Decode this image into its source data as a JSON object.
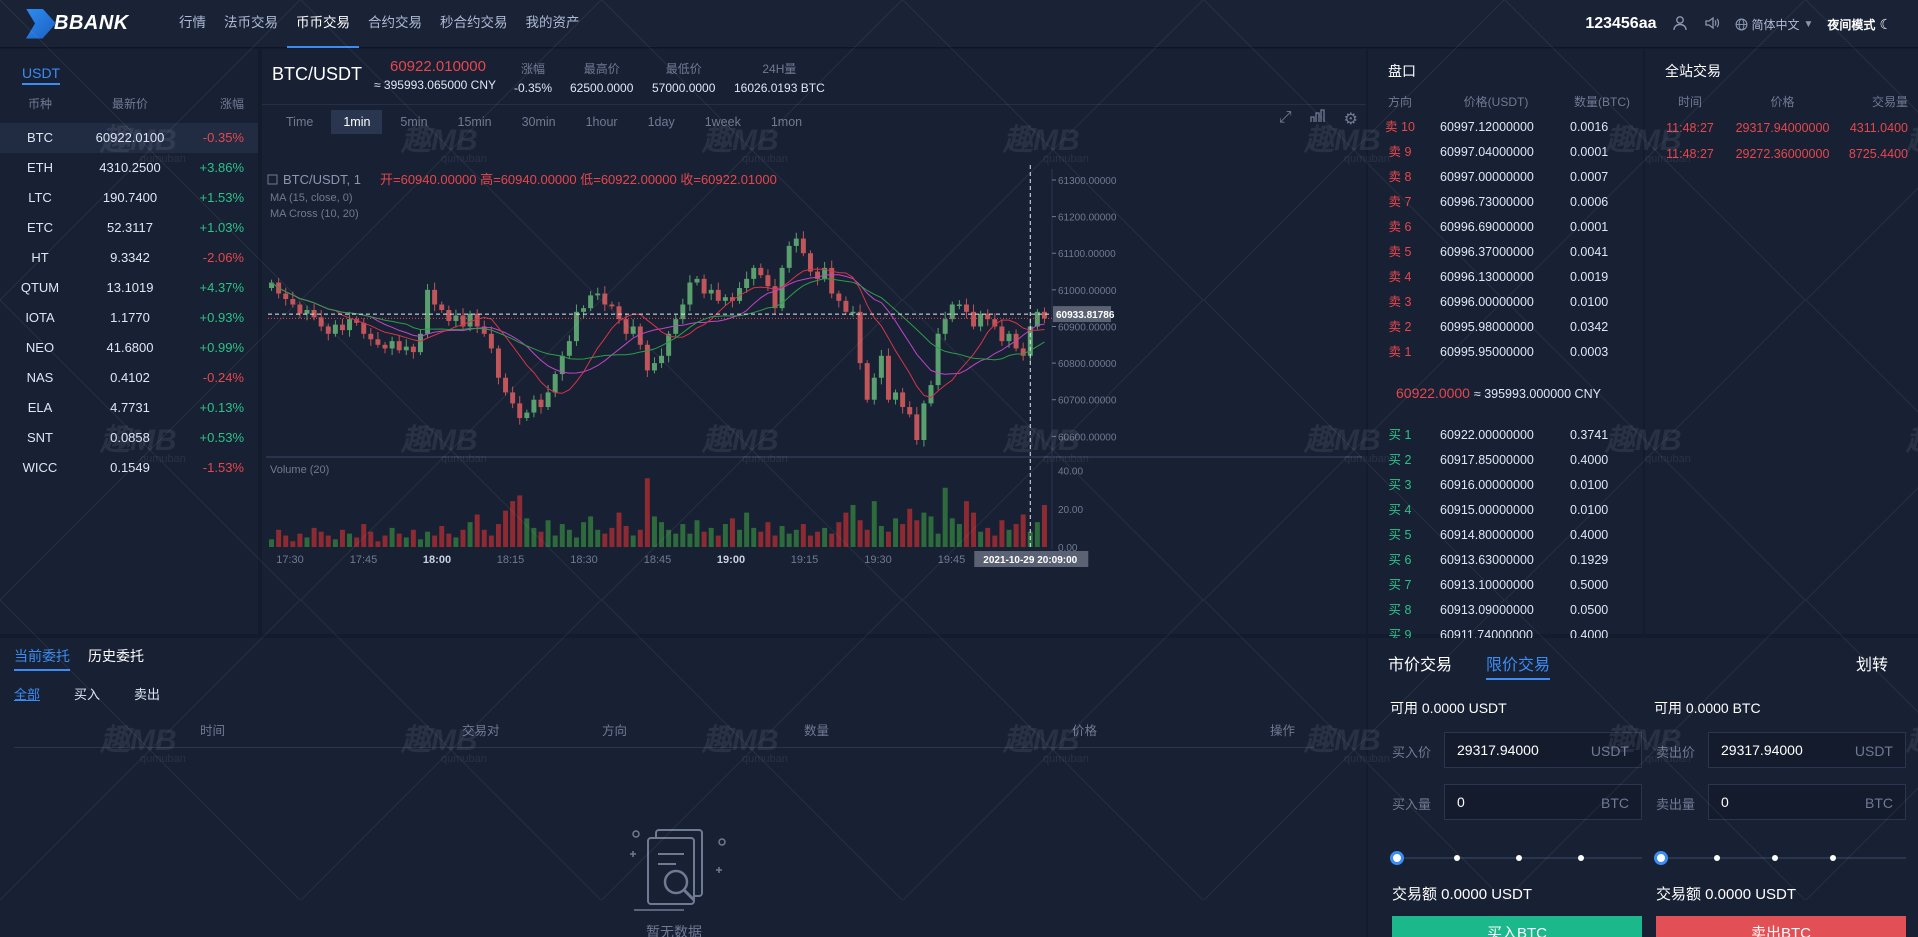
{
  "header": {
    "logo_text": "BBANK",
    "nav": [
      "行情",
      "法币交易",
      "币币交易",
      "合约交易",
      "秒合约交易",
      "我的资产"
    ],
    "active_nav": 2,
    "username": "123456aa",
    "language": "简体中文",
    "night_mode": "夜间模式"
  },
  "market": {
    "tab": "USDT",
    "columns": [
      "币种",
      "最新价",
      "涨幅"
    ],
    "rows": [
      {
        "coin": "BTC",
        "price": "60922.0100",
        "change": "-0.35%",
        "dir": "down",
        "selected": true
      },
      {
        "coin": "ETH",
        "price": "4310.2500",
        "change": "+3.86%",
        "dir": "up"
      },
      {
        "coin": "LTC",
        "price": "190.7400",
        "change": "+1.53%",
        "dir": "up"
      },
      {
        "coin": "ETC",
        "price": "52.3117",
        "change": "+1.03%",
        "dir": "up"
      },
      {
        "coin": "HT",
        "price": "9.3342",
        "change": "-2.06%",
        "dir": "down"
      },
      {
        "coin": "QTUM",
        "price": "13.1019",
        "change": "+4.37%",
        "dir": "up"
      },
      {
        "coin": "IOTA",
        "price": "1.1770",
        "change": "+0.93%",
        "dir": "up"
      },
      {
        "coin": "NEO",
        "price": "41.6800",
        "change": "+0.99%",
        "dir": "up"
      },
      {
        "coin": "NAS",
        "price": "0.4102",
        "change": "-0.24%",
        "dir": "down"
      },
      {
        "coin": "ELA",
        "price": "4.7731",
        "change": "+0.13%",
        "dir": "up"
      },
      {
        "coin": "SNT",
        "price": "0.0858",
        "change": "+0.53%",
        "dir": "up"
      },
      {
        "coin": "WICC",
        "price": "0.1549",
        "change": "-1.53%",
        "dir": "down"
      }
    ]
  },
  "ticker": {
    "pair": "BTC/USDT",
    "last_price": "60922.010000",
    "last_cny": "≈ 395993.065000 CNY",
    "change_label": "涨幅",
    "change_value": "-0.35%",
    "high_label": "最高价",
    "high_value": "62500.0000",
    "low_label": "最低价",
    "low_value": "57000.0000",
    "volume_label": "24H量",
    "volume_value": "16026.0193 BTC"
  },
  "timeframes": [
    "Time",
    "1min",
    "5min",
    "15min",
    "30min",
    "1hour",
    "1day",
    "1week",
    "1mon"
  ],
  "active_timeframe": 1,
  "chart_data": {
    "type": "candlestick",
    "legend_main": "BTC/USDT, 1",
    "ohlc_text": "开=60940.00000  高=60940.00000  低=60922.00000  收=60922.01000",
    "indicators": [
      "MA (15, close, 0)",
      "MA Cross (10, 20)"
    ],
    "volume_label": "Volume (20)",
    "price_ticks": [
      61300,
      61200,
      61100,
      61000,
      60900,
      60800,
      60700,
      60600
    ],
    "price_tick_labels": [
      "61300.00000",
      "61200.00000",
      "61100.00000",
      "61000.00000",
      "60900.00000",
      "60800.00000",
      "60700.00000",
      "60600.00000"
    ],
    "price_range": [
      60560,
      61330
    ],
    "volume_ticks": [
      "40.00",
      "20.00",
      "0.00"
    ],
    "volume_range": [
      0,
      45
    ],
    "time_ticks": [
      "17:30",
      "17:45",
      "18:00",
      "18:15",
      "18:30",
      "18:45",
      "19:00",
      "19:15",
      "19:30",
      "19:45"
    ],
    "crosshair_price": "60933.81786",
    "crosshair_time": "2021-10-29 20:09:00",
    "closes": [
      61020,
      60990,
      60975,
      60960,
      60935,
      60945,
      60925,
      60900,
      60880,
      60905,
      60890,
      60920,
      60910,
      60880,
      60865,
      60850,
      60840,
      60860,
      60835,
      60845,
      60830,
      60880,
      61000,
      60960,
      60945,
      60915,
      60930,
      60900,
      60935,
      60900,
      60880,
      60840,
      60760,
      60720,
      60690,
      60650,
      60665,
      60700,
      60680,
      60720,
      60770,
      60820,
      60860,
      60940,
      60950,
      60985,
      60990,
      60960,
      60955,
      60920,
      60880,
      60900,
      60850,
      60780,
      60800,
      60820,
      60880,
      60920,
      60960,
      61020,
      61030,
      60990,
      61000,
      60970,
      60980,
      60970,
      61005,
      61030,
      61060,
      61040,
      61010,
      60950,
      61060,
      61120,
      61140,
      61100,
      61050,
      61030,
      61060,
      60990,
      60970,
      60940,
      60940,
      60800,
      60700,
      60760,
      60820,
      60700,
      60720,
      60680,
      60660,
      60590,
      60690,
      60740,
      60880,
      60920,
      60960,
      60960,
      60940,
      60900,
      60935,
      60920,
      60900,
      60860,
      60880,
      60840,
      60820,
      60900,
      60940,
      60922
    ],
    "volumes": [
      4,
      9,
      6,
      3,
      7,
      5,
      10,
      8,
      6,
      4,
      9,
      7,
      5,
      12,
      8,
      3,
      6,
      10,
      7,
      5,
      9,
      4,
      8,
      6,
      11,
      7,
      5,
      9,
      13,
      17,
      9,
      6,
      12,
      19,
      24,
      27,
      15,
      10,
      8,
      14,
      6,
      12,
      9,
      5,
      13,
      16,
      9,
      7,
      10,
      18,
      11,
      6,
      9,
      36,
      16,
      13,
      9,
      7,
      12,
      7,
      14,
      8,
      10,
      6,
      12,
      15,
      9,
      18,
      10,
      8,
      13,
      6,
      11,
      7,
      9,
      12,
      6,
      8,
      10,
      7,
      13,
      18,
      22,
      14,
      9,
      24,
      11,
      8,
      15,
      12,
      20,
      14,
      18,
      16,
      7,
      31,
      15,
      12,
      24,
      18,
      8,
      10,
      6,
      14,
      9,
      12,
      17,
      8,
      13,
      22
    ],
    "orange_line_price": 60922
  },
  "orderbook": {
    "title": "盘口",
    "columns": [
      "方向",
      "价格(USDT)",
      "数量(BTC)"
    ],
    "asks": [
      {
        "side": "卖 10",
        "price": "60997.12000000",
        "qty": "0.0016"
      },
      {
        "side": "卖 9",
        "price": "60997.04000000",
        "qty": "0.0001"
      },
      {
        "side": "卖 8",
        "price": "60997.00000000",
        "qty": "0.0007"
      },
      {
        "side": "卖 7",
        "price": "60996.73000000",
        "qty": "0.0006"
      },
      {
        "side": "卖 6",
        "price": "60996.69000000",
        "qty": "0.0001"
      },
      {
        "side": "卖 5",
        "price": "60996.37000000",
        "qty": "0.0041"
      },
      {
        "side": "卖 4",
        "price": "60996.13000000",
        "qty": "0.0019"
      },
      {
        "side": "卖 3",
        "price": "60996.00000000",
        "qty": "0.0100"
      },
      {
        "side": "卖 2",
        "price": "60995.98000000",
        "qty": "0.0342"
      },
      {
        "side": "卖 1",
        "price": "60995.95000000",
        "qty": "0.0003"
      }
    ],
    "mid_price": "60922.0000",
    "mid_cny": "≈ 395993.000000 CNY",
    "bids": [
      {
        "side": "买 1",
        "price": "60922.00000000",
        "qty": "0.3741"
      },
      {
        "side": "买 2",
        "price": "60917.85000000",
        "qty": "0.4000"
      },
      {
        "side": "买 3",
        "price": "60916.00000000",
        "qty": "0.0100"
      },
      {
        "side": "买 4",
        "price": "60915.00000000",
        "qty": "0.0100"
      },
      {
        "side": "买 5",
        "price": "60914.80000000",
        "qty": "0.4000"
      },
      {
        "side": "买 6",
        "price": "60913.63000000",
        "qty": "0.1929"
      },
      {
        "side": "买 7",
        "price": "60913.10000000",
        "qty": "0.5000"
      },
      {
        "side": "买 8",
        "price": "60913.09000000",
        "qty": "0.0500"
      },
      {
        "side": "买 9",
        "price": "60911.74000000",
        "qty": "0.4000"
      }
    ]
  },
  "trades": {
    "title": "全站交易",
    "columns": [
      "时间",
      "价格",
      "交易量"
    ],
    "rows": [
      {
        "time": "11:48:27",
        "price": "29317.94000000",
        "qty": "4311.0400"
      },
      {
        "time": "11:48:27",
        "price": "29272.36000000",
        "qty": "8725.4400"
      }
    ]
  },
  "orders": {
    "tabs": [
      "当前委托",
      "历史委托"
    ],
    "active_tab": 0,
    "filters": [
      "全部",
      "买入",
      "卖出"
    ],
    "active_filter": 0,
    "columns": [
      "时间",
      "交易对",
      "方向",
      "数量",
      "价格",
      "操作"
    ],
    "empty_text": "暂无数据"
  },
  "trade_form": {
    "tabs": [
      "市价交易",
      "限价交易"
    ],
    "active_tab": 1,
    "transfer": "划转",
    "buy": {
      "available": "可用 0.0000 USDT",
      "price_label": "买入价",
      "price_value": "29317.94000",
      "price_unit": "USDT",
      "qty_label": "买入量",
      "qty_value": "0",
      "qty_unit": "BTC",
      "amount": "交易额 0.0000 USDT",
      "button": "买入BTC",
      "slider_value": 0
    },
    "sell": {
      "available": "可用 0.0000 BTC",
      "price_label": "卖出价",
      "price_value": "29317.94000",
      "price_unit": "USDT",
      "qty_label": "卖出量",
      "qty_value": "0",
      "qty_unit": "BTC",
      "amount": "交易额 0.0000 USDT",
      "button": "卖出BTC",
      "slider_value": 0
    }
  },
  "watermark": {
    "text": "趣MB",
    "sub": "qumuban"
  },
  "colors": {
    "up": "#2bc287",
    "down": "#e6474d",
    "accent": "#3b8cf4",
    "bg": "#141b2c",
    "panel": "#182033"
  }
}
